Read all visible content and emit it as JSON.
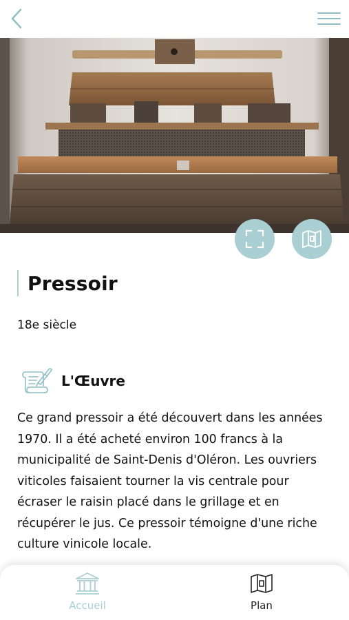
{
  "header": {
    "back_icon": "chevron-left-icon",
    "menu_icon": "hamburger-menu-icon"
  },
  "hero": {
    "image": "wooden-wine-press-photo",
    "fullscreen_icon": "fullscreen-icon",
    "map_icon": "map-icon"
  },
  "artwork": {
    "title": "Pressoir",
    "century": "18e siècle"
  },
  "section": {
    "icon": "scroll-quill-icon",
    "label": "L'Œuvre",
    "text": "Ce grand pressoir a été découvert dans les années 1970. Il a été acheté environ 100 francs à la municipalité de Saint-Denis d'Oléron. Les ouvriers viticoles faisaient tourner la vis centrale pour écraser le raisin placé dans le grillage et en récupérer le jus. Ce pressoir témoigne d'une riche culture vinicole locale."
  },
  "bottom_nav": {
    "items": [
      {
        "label": "Accueil",
        "icon": "museum-icon",
        "active": true
      },
      {
        "label": "Plan",
        "icon": "map-icon",
        "active": false
      }
    ]
  },
  "colors": {
    "accent": "#a9cfd3",
    "accent_dark": "#8fbfc6",
    "text": "#111111"
  }
}
